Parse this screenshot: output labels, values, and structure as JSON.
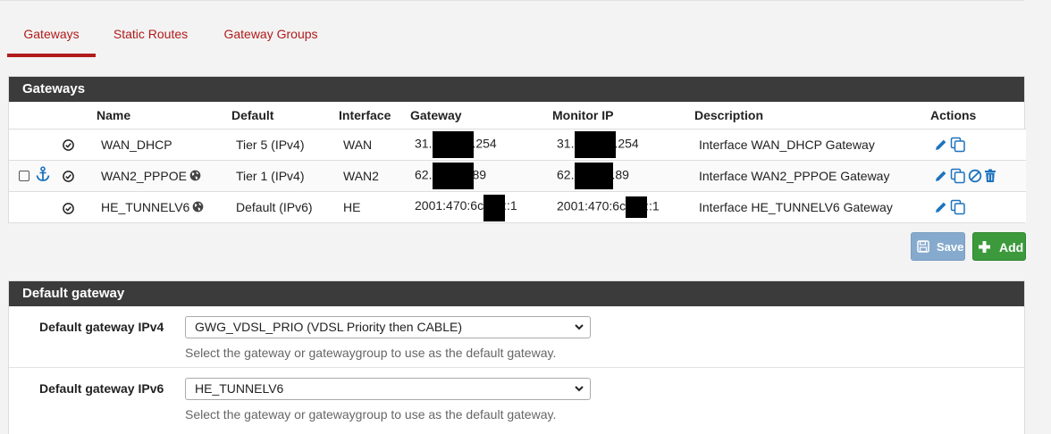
{
  "tabs": [
    {
      "label": "Gateways",
      "active": true
    },
    {
      "label": "Static Routes",
      "active": false
    },
    {
      "label": "Gateway Groups",
      "active": false
    }
  ],
  "gateways_panel": {
    "title": "Gateways",
    "columns": [
      "Name",
      "Default",
      "Interface",
      "Gateway",
      "Monitor IP",
      "Description",
      "Actions"
    ],
    "rows": [
      {
        "name": "WAN_DHCP",
        "default": "Tier 5 (IPv4)",
        "interface": "WAN",
        "gateway_prefix": "31.",
        "gateway_suffix": ".254",
        "monitor_prefix": "31.",
        "monitor_suffix": ".254",
        "description": "Interface WAN_DHCP Gateway"
      },
      {
        "name": "WAN2_PPPOE",
        "default": "Tier 1 (IPv4)",
        "interface": "WAN2",
        "gateway_prefix": "62.",
        "gateway_suffix": "89",
        "monitor_prefix": "62.",
        "monitor_suffix": ".89",
        "description": "Interface WAN2_PPPOE Gateway"
      },
      {
        "name": "HE_TUNNELV6",
        "default": "Default (IPv6)",
        "interface": "HE",
        "gateway_prefix": "2001:470:6c",
        "gateway_suffix": "::1",
        "monitor_prefix": "2001:470:6c",
        "monitor_suffix": "::1",
        "description": "Interface HE_TUNNELV6 Gateway"
      }
    ]
  },
  "buttons": {
    "save": "Save",
    "add": "Add"
  },
  "default_gateway_panel": {
    "title": "Default gateway",
    "ipv4": {
      "label": "Default gateway IPv4",
      "value": "GWG_VDSL_PRIO (VDSL Priority then CABLE)",
      "help": "Select the gateway or gatewaygroup to use as the default gateway."
    },
    "ipv6": {
      "label": "Default gateway IPv6",
      "value": "HE_TUNNELV6",
      "help": "Select the gateway or gatewaygroup to use as the default gateway."
    }
  },
  "colors": {
    "accent": "#b11b1b",
    "panel_header": "#3b3b3b",
    "action_blue": "#1e73be",
    "save_button": "#86aacd",
    "add_button": "#3c9a3c"
  },
  "icons": [
    "check-circle-icon",
    "globe-icon",
    "anchor-icon",
    "pencil-icon",
    "copy-icon",
    "disable-icon",
    "trash-icon",
    "floppy-icon",
    "plus-icon",
    "chevron-down-icon"
  ]
}
